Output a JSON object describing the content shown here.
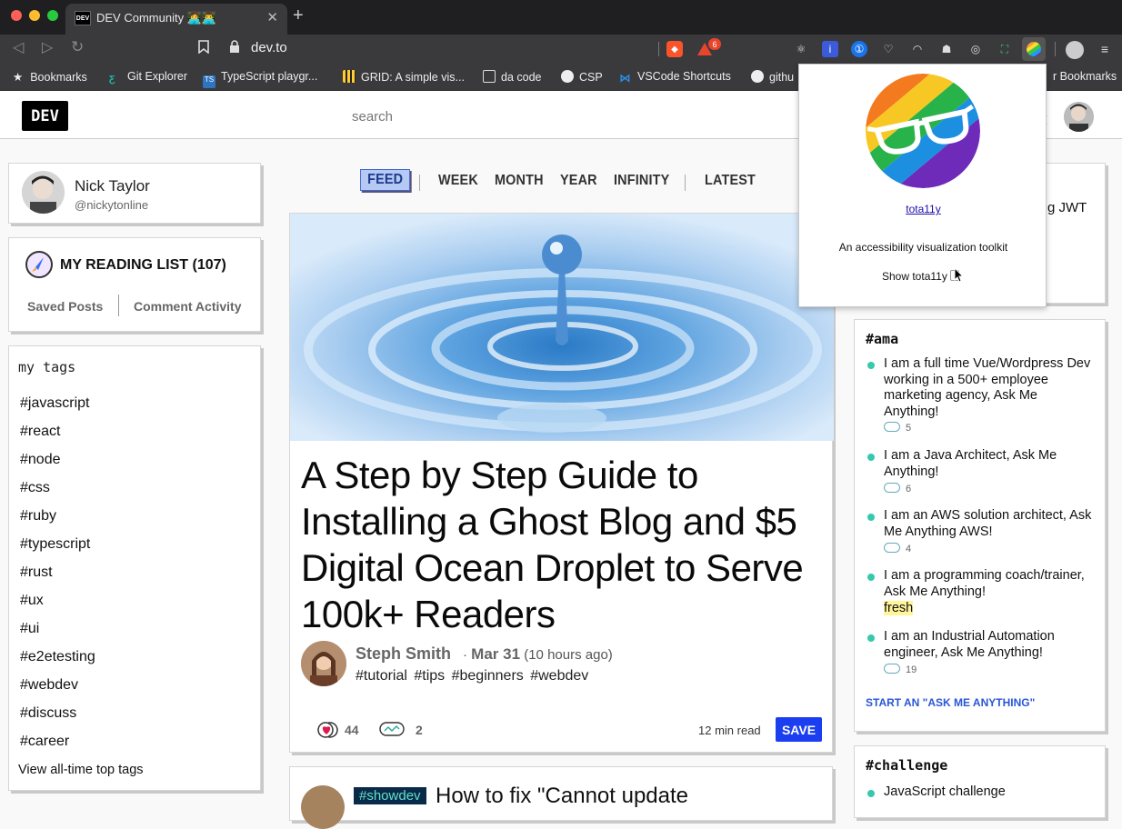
{
  "browser": {
    "tab_title": "DEV Community 👩‍💻👨‍💻",
    "favicon_text": "DEV",
    "url": "dev.to",
    "shield_badge": "6",
    "bookmarks": [
      {
        "label": "Bookmarks"
      },
      {
        "label": "Git Explorer"
      },
      {
        "label": "TypeScript playgr..."
      },
      {
        "label": "GRID: A simple vis..."
      },
      {
        "label": "da code"
      },
      {
        "label": "CSP"
      },
      {
        "label": "VSCode Shortcuts"
      },
      {
        "label": "githu"
      },
      {
        "label": "r Bookmarks"
      }
    ]
  },
  "header": {
    "logo": "DEV",
    "search_placeholder": "search"
  },
  "profile": {
    "name": "Nick Taylor",
    "handle": "@nickytonline"
  },
  "reading_list": {
    "title": "MY READING LIST (107)",
    "saved_posts": "Saved Posts",
    "comment_activity": "Comment Activity"
  },
  "tags": {
    "heading": "my tags",
    "items": [
      "#javascript",
      "#react",
      "#node",
      "#css",
      "#ruby",
      "#typescript",
      "#rust",
      "#ux",
      "#ui",
      "#e2etesting",
      "#webdev",
      "#discuss",
      "#career"
    ],
    "view_all": "View all-time top tags"
  },
  "feed_nav": {
    "items": [
      "FEED",
      "WEEK",
      "MONTH",
      "YEAR",
      "INFINITY",
      "LATEST"
    ]
  },
  "article": {
    "title": "A Step by Step Guide to Installing a Ghost Blog and $5 Digital Ocean Droplet to Serve 100k+ Readers",
    "author": "Steph Smith",
    "date": "Mar 31",
    "relative_date": "(10 hours ago)",
    "tags": "#tutorial #tips #beginners #webdev",
    "reactions": "44",
    "comments": "2",
    "read_time": "12 min read",
    "save_label": "SAVE"
  },
  "next_article": {
    "badge": "#showdev",
    "title_partial": "How to fix \"Cannot update"
  },
  "right_sidebar": {
    "partial_text": "g JWT",
    "ama": {
      "heading": "#ama",
      "items": [
        {
          "text": "I am a full time Vue/Wordpress Dev working in a 500+ employee marketing agency, Ask Me Anything!",
          "count": "5"
        },
        {
          "text": "I am a Java Architect, Ask Me Anything!",
          "count": "6"
        },
        {
          "text": "I am an AWS solution architect, Ask Me Anything AWS!",
          "count": "4"
        },
        {
          "text": "I am a programming coach/trainer, Ask Me Anything!",
          "badge": "fresh"
        },
        {
          "text": "I am an Industrial Automation engineer, Ask Me Anything!",
          "count": "19"
        }
      ],
      "cta": "START AN \"ASK ME ANYTHING\""
    },
    "challenge": {
      "heading": "#challenge",
      "first_item": "JavaScript challenge"
    }
  },
  "popup": {
    "name": "tota11y",
    "description": "An accessibility visualization toolkit",
    "show_label": "Show tota11y"
  },
  "colors": {
    "save_button": "#1a3ef0",
    "feed_active": "#b5c9f4",
    "ama_dot": "#36c9ac"
  }
}
